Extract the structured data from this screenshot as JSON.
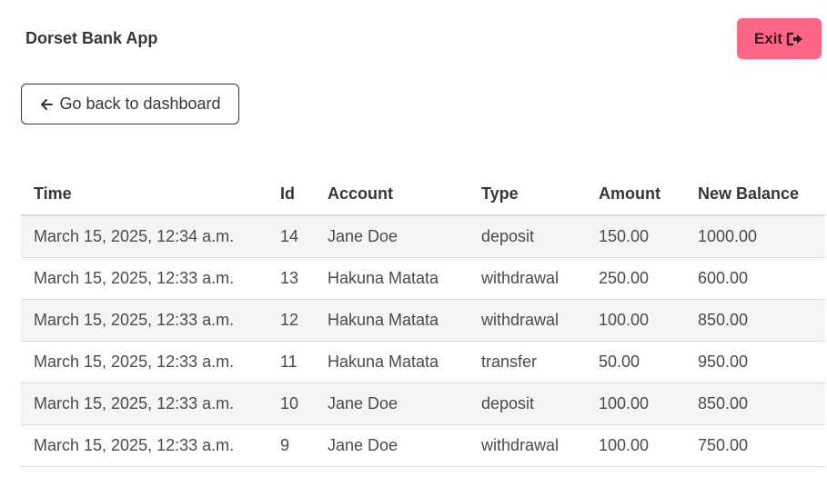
{
  "header": {
    "app_title": "Dorset Bank App",
    "exit_label": "Exit",
    "exit_icon": "sign-out-icon",
    "accent_color": "#ff6685"
  },
  "nav": {
    "back_label": "Go back to dashboard",
    "back_icon": "arrow-left-icon"
  },
  "table": {
    "columns": [
      "Time",
      "Id",
      "Account",
      "Type",
      "Amount",
      "New Balance"
    ],
    "rows": [
      [
        "March 15, 2025, 12:34 a.m.",
        "14",
        "Jane Doe",
        "deposit",
        "150.00",
        "1000.00"
      ],
      [
        "March 15, 2025, 12:33 a.m.",
        "13",
        "Hakuna Matata",
        "withdrawal",
        "250.00",
        "600.00"
      ],
      [
        "March 15, 2025, 12:33 a.m.",
        "12",
        "Hakuna Matata",
        "withdrawal",
        "100.00",
        "850.00"
      ],
      [
        "March 15, 2025, 12:33 a.m.",
        "11",
        "Hakuna Matata",
        "transfer",
        "50.00",
        "950.00"
      ],
      [
        "March 15, 2025, 12:33 a.m.",
        "10",
        "Jane Doe",
        "deposit",
        "100.00",
        "850.00"
      ],
      [
        "March 15, 2025, 12:33 a.m.",
        "9",
        "Jane Doe",
        "withdrawal",
        "100.00",
        "750.00"
      ]
    ]
  }
}
